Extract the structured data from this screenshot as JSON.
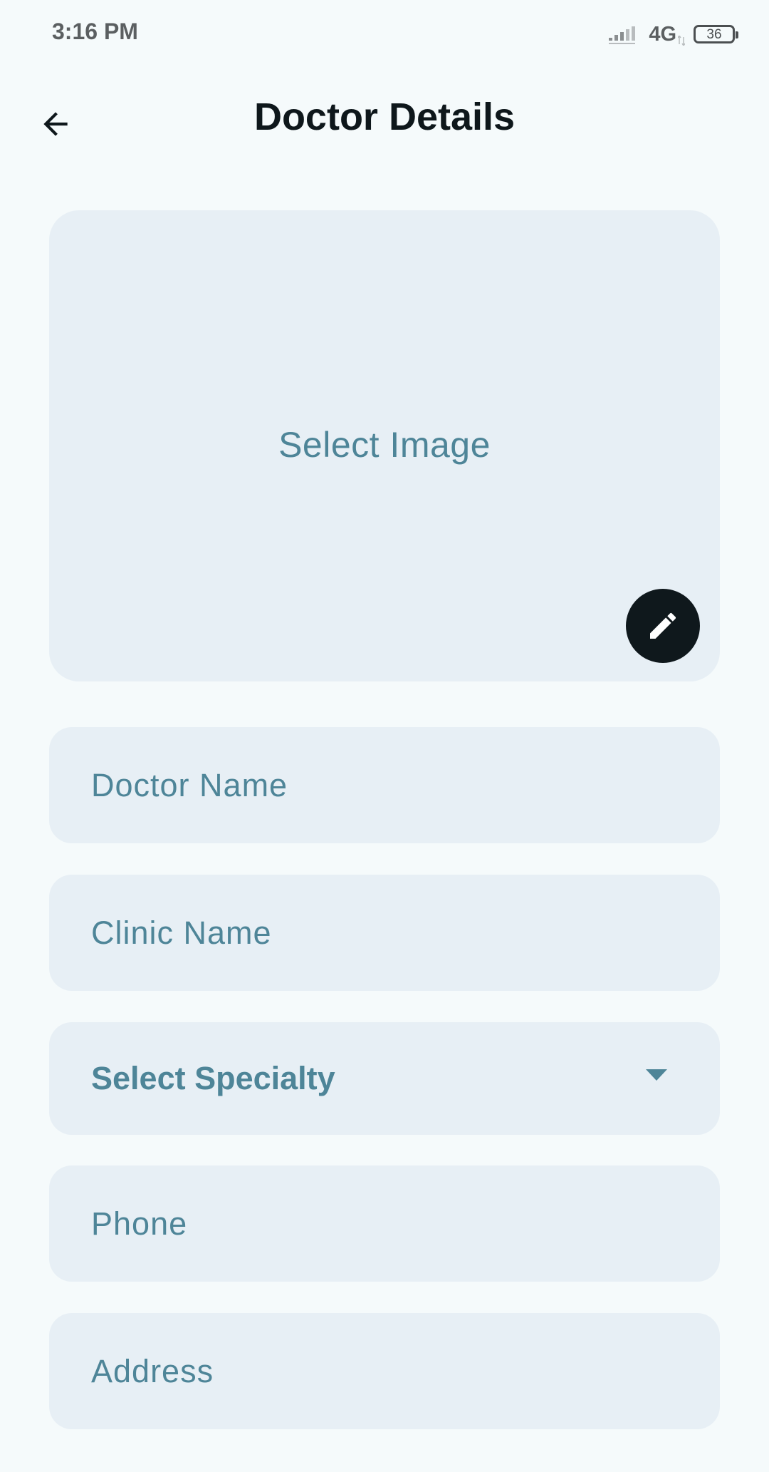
{
  "status_bar": {
    "time": "3:16 PM",
    "network": "4G",
    "battery": "36"
  },
  "app_bar": {
    "title": "Doctor Details",
    "back_icon": "arrow-back-icon"
  },
  "image_picker": {
    "label": "Select Image",
    "edit_icon": "pencil-icon"
  },
  "form": {
    "doctor_name": {
      "placeholder": "Doctor Name",
      "value": ""
    },
    "clinic_name": {
      "placeholder": "Clinic Name",
      "value": ""
    },
    "specialty": {
      "selected": "Select Specialty",
      "icon": "dropdown-arrow-icon"
    },
    "phone": {
      "placeholder": "Phone",
      "value": ""
    },
    "address": {
      "placeholder": "Address",
      "value": ""
    }
  },
  "colors": {
    "background": "#f5fafb",
    "field_background": "#e7eff5",
    "placeholder_text": "#4e8598",
    "title_text": "#0e171b",
    "fab_background": "#0f181c"
  }
}
